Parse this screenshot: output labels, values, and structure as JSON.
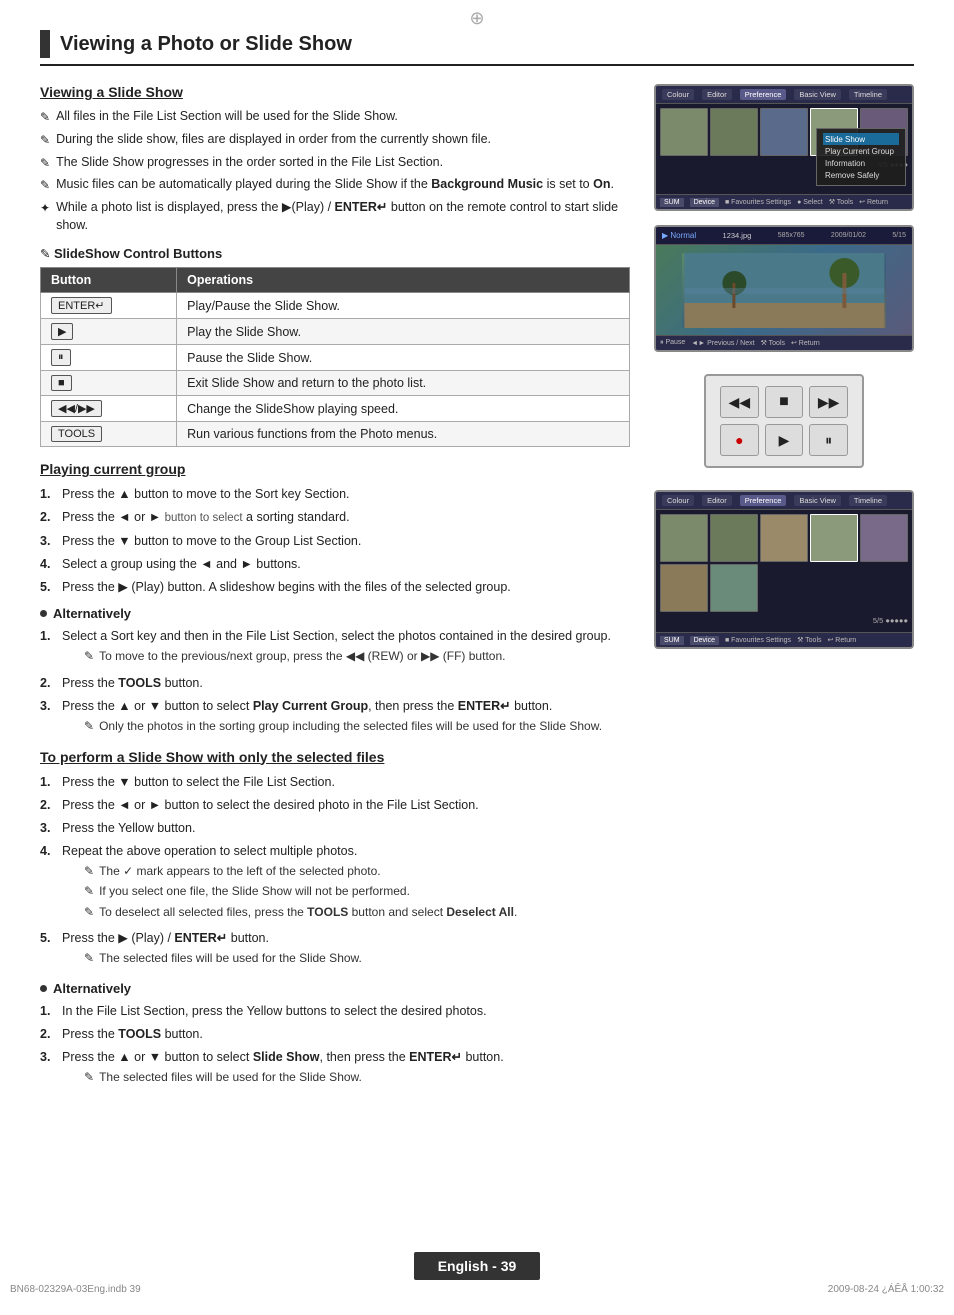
{
  "page": {
    "title": "Viewing a Photo or Slide Show",
    "footer_text": "English - 39",
    "footer_left": "BN68-02329A-03Eng.indb   39",
    "footer_right": "2009-08-24   ¿ÁÊÅ 1:00:32",
    "crosshair": "⊕",
    "corner_tl": "",
    "corner_tr": ""
  },
  "section1": {
    "heading": "Viewing a Slide Show",
    "notes": [
      "All files in the File List Section will be used for the Slide Show.",
      "During the slide show, files are displayed in order from the currently shown file.",
      "The Slide Show progresses in the order sorted in the File List Section.",
      "Music files can be automatically played during the Slide Show if the Background Music is set to On.",
      "While a photo list is displayed, press the ▶(Play) / ENTER↵ button on the remote control to start slide show."
    ],
    "note_bold_1": "Background Music",
    "note_bold_2": "On",
    "control_buttons_heading": "SlideShow Control Buttons",
    "table": {
      "col1": "Button",
      "col2": "Operations",
      "rows": [
        {
          "btn": "ENTER↵",
          "op": "Play/Pause the Slide Show."
        },
        {
          "btn": "▶",
          "op": "Play the Slide Show."
        },
        {
          "btn": "⏸",
          "op": "Pause the Slide Show."
        },
        {
          "btn": "■",
          "op": "Exit Slide Show and return to the photo list."
        },
        {
          "btn": "◀◀/▶▶",
          "op": "Change the SlideShow playing speed."
        },
        {
          "btn": "TOOLS",
          "op": "Run various functions from the Photo menus."
        }
      ]
    }
  },
  "section2": {
    "heading": "Playing current group",
    "steps": [
      "Press the ▲ button to move to the Sort key Section.",
      "Press the ◄ or ► button to select a sorting standard.",
      "Press the ▼ button to move to the Group List Section.",
      "Select a group using the ◄ and ► buttons.",
      "Press the ▶ (Play) button.  A slideshow begins with the files of the selected group."
    ],
    "alt_heading": "Alternatively",
    "alt_steps": [
      "Select a Sort key and then in the File List Section, select the photos contained in the desired group.",
      "Press the TOOLS button.",
      "Press the ▲ or ▼ button to select Play Current Group, then press the ENTER↵ button."
    ],
    "alt_note1": "To move to the previous/next group, press the ◀◀ (REW) or ▶▶ (FF) button.",
    "alt_note2": "Only the photos in the sorting group including the selected files will be used for the Slide Show.",
    "alt_step3_bold": "Play Current Group",
    "alt_step3_enter": "ENTER↵"
  },
  "section3": {
    "heading": "To perform a Slide Show with only the selected files",
    "steps": [
      "Press the ▼ button to select the File List Section.",
      "Press the ◄ or ► button to select the desired photo in the File List Section.",
      "Press the Yellow button.",
      "Repeat the above operation to select multiple photos.",
      "Press the ▶ (Play) / ENTER↵ button."
    ],
    "step4_notes": [
      "The ✓ mark appears to the left of the selected photo.",
      "If you select one file, the Slide Show will not be performed.",
      "To deselect all selected files, press the TOOLS button and select Deselect All."
    ],
    "step5_note": "The selected files will be used for the Slide Show.",
    "step4_note3_bold1": "TOOLS",
    "step4_note3_bold2": "Deselect All",
    "alt_heading": "Alternatively",
    "alt_steps": [
      "In the File List Section, press the Yellow buttons to select the desired photos.",
      "Press the TOOLS button.",
      "Press the ▲ or ▼ button to select Slide Show, then press the ENTER↵ button."
    ],
    "alt_step3_bold": "Slide Show",
    "alt_step3_note": "The selected files will be used for the Slide Show."
  },
  "ui_labels": {
    "normal": "Normal",
    "filename": "1234.jpg",
    "resolution": "585x765",
    "date": "2009/01/02",
    "page_num": "5/15",
    "tabs": [
      "Colour",
      "Editor",
      "Preference",
      "Basic View",
      "Timeline"
    ],
    "bottom_btns": [
      "SUM",
      "Device",
      "Favourites Settings",
      "Select",
      "Tools",
      "Return"
    ],
    "menu_items": [
      "Slide Show",
      "Play Current Group",
      "Information",
      "Remove Safely"
    ],
    "remote_btns": [
      "◀◀",
      "■",
      "▶▶",
      "●",
      "▶",
      "⏸"
    ]
  },
  "icons": {
    "note": "✎",
    "note2": "✦",
    "bullet": "●",
    "check": "✓"
  }
}
